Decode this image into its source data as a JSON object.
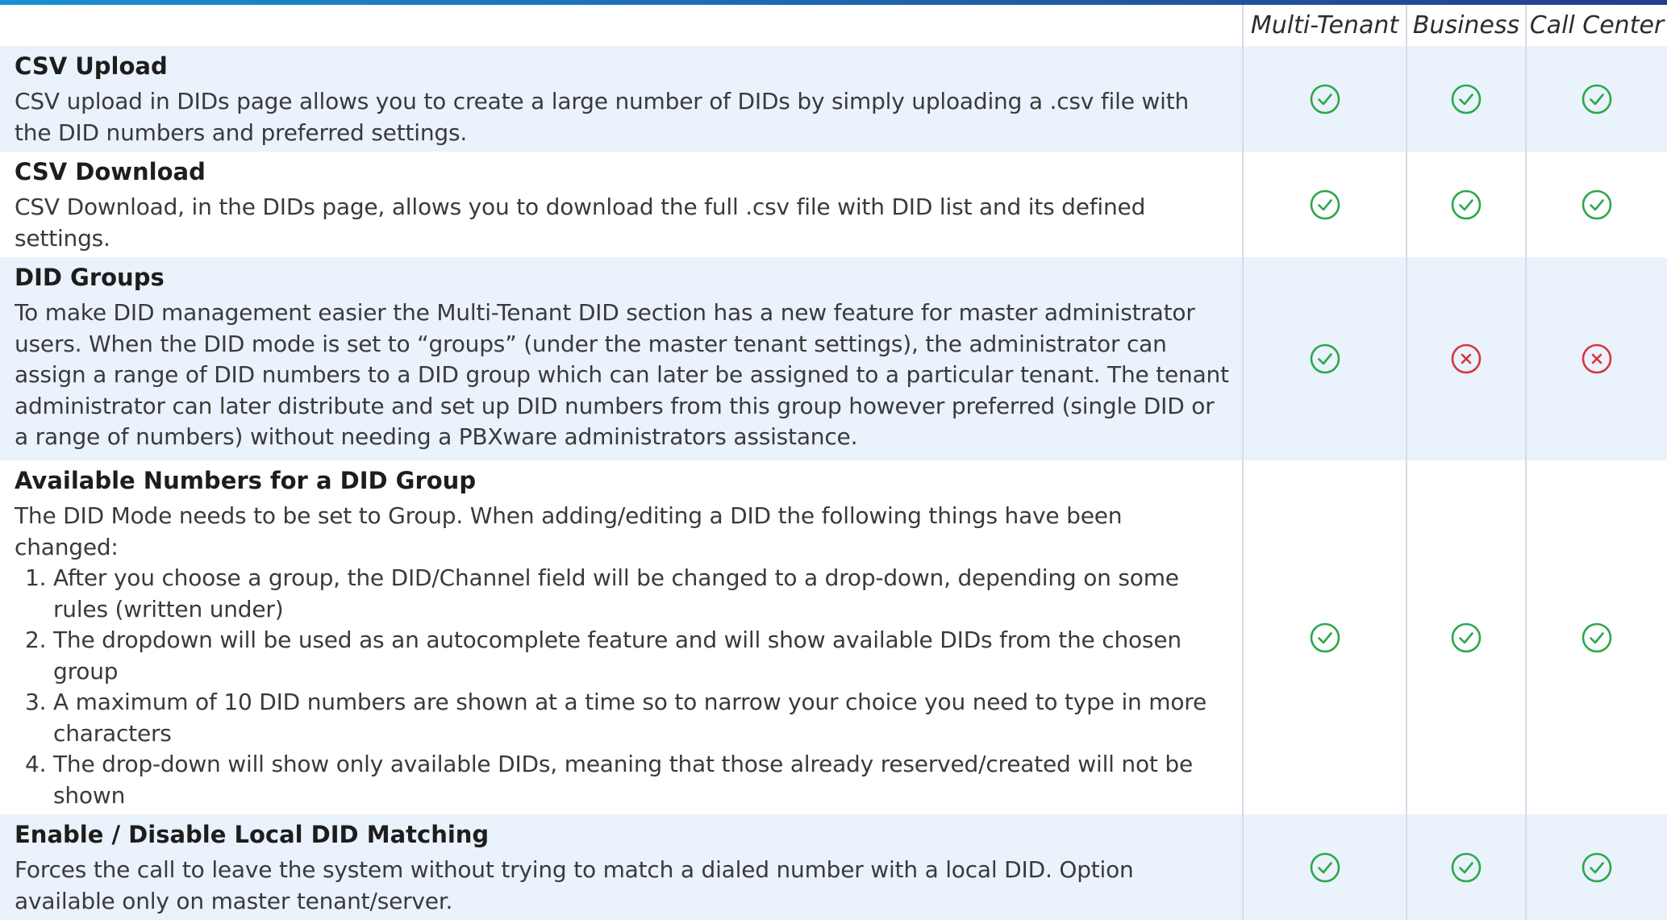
{
  "columns": [
    "Multi-Tenant",
    "Business",
    "Call Center"
  ],
  "colors": {
    "yes": "#2aa84a",
    "no": "#d8343c",
    "row_shade": "#eaf2fb",
    "header_bar": "#1f5ea8"
  },
  "rows": [
    {
      "title": "CSV Upload",
      "description": "CSV upload in DIDs page allows you to create a large number of DIDs by simply uploading a .csv file with the DID numbers and preferred settings.",
      "availability": [
        "yes",
        "yes",
        "yes"
      ]
    },
    {
      "title": "CSV Download",
      "description": "CSV Download, in the DIDs page, allows you to download the full .csv file with DID list and its defined settings.",
      "availability": [
        "yes",
        "yes",
        "yes"
      ]
    },
    {
      "title": "DID Groups",
      "description": "To make DID management easier the Multi-Tenant DID section has a new feature for master administrator users. When the DID mode is set to “groups” (under the master tenant settings), the administrator can assign a range of DID numbers to a DID group which can later be assigned to a particular tenant. The tenant administrator can later distribute and set up DID numbers from this group however preferred (single DID or a range of numbers) without needing a PBXware administrators assistance.",
      "availability": [
        "yes",
        "no",
        "no"
      ]
    },
    {
      "title": "Available Numbers for a DID Group",
      "description": "The DID Mode needs to be set to Group. When adding/editing a DID the following things have been changed:",
      "items": [
        "After you choose a group, the DID/Channel field will be changed to a drop-down, depending on some rules (written under)",
        "The dropdown will be used as an autocomplete feature and will show available DIDs from the chosen group",
        "A maximum of 10 DID numbers are shown at a time so to narrow your choice you need to type in more characters",
        "The drop-down will show only available DIDs, meaning that those already reserved/created will not be shown"
      ],
      "availability": [
        "yes",
        "yes",
        "yes"
      ]
    },
    {
      "title": "Enable / Disable Local DID Matching",
      "description": "Forces the call to leave the system without trying to match a dialed number with a local DID. Option available only on master tenant/server.",
      "availability": [
        "yes",
        "yes",
        "yes"
      ]
    }
  ]
}
